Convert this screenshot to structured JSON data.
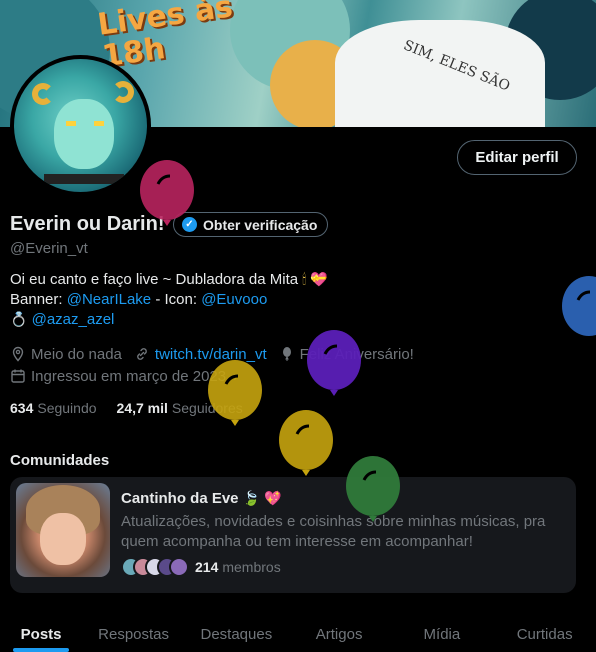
{
  "banner": {
    "text": "Lives às 18h",
    "tee_text": "SIM, ELES SÃO"
  },
  "profile": {
    "name": "Everin ou Darin!",
    "verify_label": "Obter verificação",
    "handle": "@Everin_vt",
    "edit_label": "Editar perfil"
  },
  "bio": {
    "line1": "Oi eu canto e faço live ~ Dubladora da Mita",
    "line2_prefix": "Banner: ",
    "banner_credit": "@NearILake",
    "line2_mid": " - Icon: ",
    "icon_credit": "@Euvooo",
    "line3_link": "@azaz_azel"
  },
  "meta": {
    "location": "Meio do nada",
    "website": "twitch.tv/darin_vt",
    "birthday": "Feliz Aniversário!",
    "joined": "Ingressou em março de 2023"
  },
  "stats": {
    "following_count": "634",
    "following_label": "Seguindo",
    "followers_count": "24,7 mil",
    "followers_label": "Seguidores"
  },
  "communities": {
    "title": "Comunidades",
    "card": {
      "name": "Cantinho da Eve",
      "description": "Atualizações, novidades e coisinhas sobre minhas músicas, pra quem acompanha ou tem interesse em acompanhar!",
      "member_count": "214",
      "member_label": "membros"
    }
  },
  "tabs": [
    "Posts",
    "Respostas",
    "Destaques",
    "Artigos",
    "Mídia",
    "Curtidas"
  ],
  "colors": {
    "accent": "#1d9bf0",
    "balloon_colors": [
      "#b8245e",
      "#5b1fb8",
      "#c6a40e",
      "#c6a40e",
      "#2f7a3a",
      "#2a5fae"
    ]
  }
}
